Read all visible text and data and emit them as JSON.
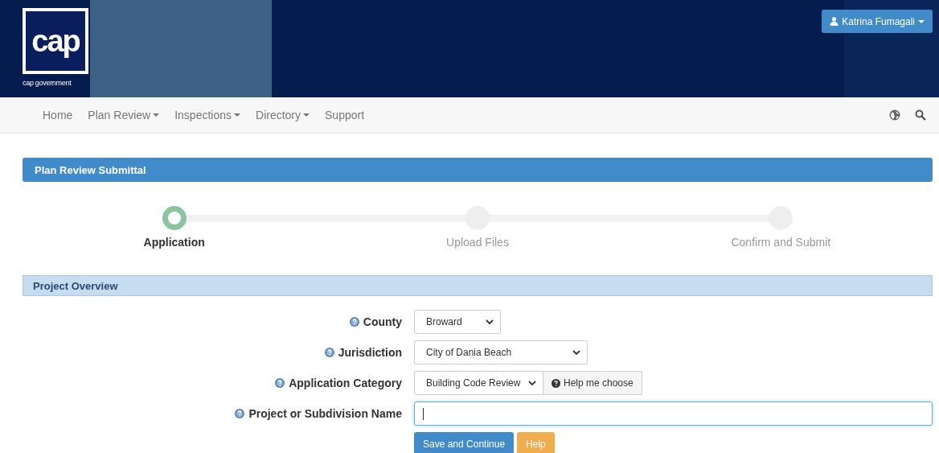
{
  "header": {
    "logo_text": "cap",
    "logo_caption": "cap government",
    "user_menu": "Katrina Fumagali"
  },
  "nav": {
    "items": [
      {
        "label": "Home",
        "dropdown": false
      },
      {
        "label": "Plan Review",
        "dropdown": true
      },
      {
        "label": "Inspections",
        "dropdown": true
      },
      {
        "label": "Directory",
        "dropdown": true
      },
      {
        "label": "Support",
        "dropdown": false
      }
    ]
  },
  "panel": {
    "title": "Plan Review Submittal"
  },
  "steps": [
    {
      "label": "Application",
      "selected": true
    },
    {
      "label": "Upload Files",
      "selected": false
    },
    {
      "label": "Confirm and Submit",
      "selected": false
    }
  ],
  "section": {
    "title": "Project Overview"
  },
  "fields": [
    {
      "kind": "select",
      "label": "County",
      "value": "Broward"
    },
    {
      "kind": "select",
      "label": "Jurisdiction",
      "value": "City of Dania Beach"
    },
    {
      "kind": "select",
      "label": "Application Category",
      "value": "Building Code Review",
      "button": "Help me choose"
    },
    {
      "kind": "text",
      "label": "Project or Subdivision Name"
    }
  ],
  "buttons": [
    {
      "label": "Save and Continue",
      "kind": "primary"
    },
    {
      "label": "Help",
      "kind": "warning"
    }
  ]
}
